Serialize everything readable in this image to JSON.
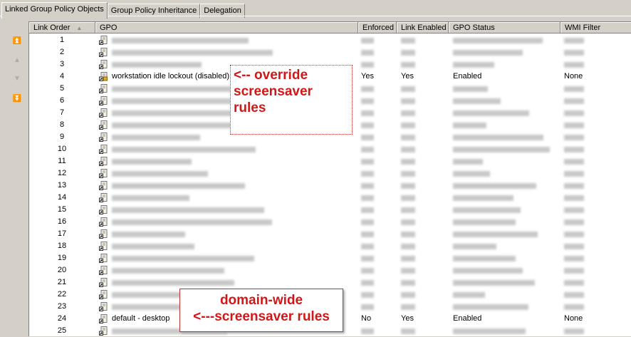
{
  "tabs": [
    "Linked Group Policy Objects",
    "Group Policy Inheritance",
    "Delegation"
  ],
  "side_buttons": [
    "move-top",
    "move-up",
    "move-down",
    "move-bottom"
  ],
  "columns": [
    "Link Order",
    "GPO",
    "Enforced",
    "Link Enabled",
    "GPO Status",
    "WMI Filter"
  ],
  "sort_indicator": "▲",
  "rows": [
    {
      "order": "1"
    },
    {
      "order": "2"
    },
    {
      "order": "3"
    },
    {
      "order": "4",
      "gpo": "workstation idle lockout (disabled)",
      "enforced": "Yes",
      "link_enabled": "Yes",
      "status": "Enabled",
      "wmi": "None",
      "locked": true
    },
    {
      "order": "5"
    },
    {
      "order": "6"
    },
    {
      "order": "7"
    },
    {
      "order": "8"
    },
    {
      "order": "9"
    },
    {
      "order": "10"
    },
    {
      "order": "11"
    },
    {
      "order": "12"
    },
    {
      "order": "13"
    },
    {
      "order": "14"
    },
    {
      "order": "15"
    },
    {
      "order": "16"
    },
    {
      "order": "17"
    },
    {
      "order": "18"
    },
    {
      "order": "19"
    },
    {
      "order": "20"
    },
    {
      "order": "21"
    },
    {
      "order": "22"
    },
    {
      "order": "23"
    },
    {
      "order": "24",
      "gpo": "default - desktop",
      "enforced": "No",
      "link_enabled": "Yes",
      "status": "Enabled",
      "wmi": "None"
    },
    {
      "order": "25"
    }
  ],
  "annotations": {
    "override": [
      "<-- override",
      "screensaver",
      "rules"
    ],
    "domain": [
      "domain-wide",
      "<---screensaver rules"
    ]
  },
  "colors": {
    "annotation": "#d01818"
  }
}
